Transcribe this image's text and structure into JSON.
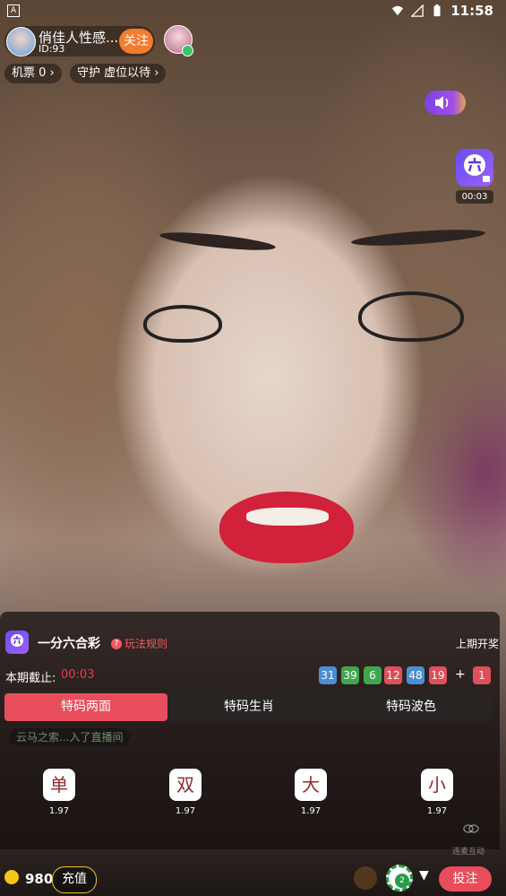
{
  "status_bar": {
    "notification_icon": "A",
    "time": "11:58",
    "icons": [
      "wifi-icon",
      "signal-icon",
      "battery-icon"
    ]
  },
  "host": {
    "name": "俏佳人性感...",
    "id_label": "ID:93",
    "follow_label": "关注"
  },
  "tags": {
    "tickets": "机票 0",
    "guard": "守护 虚位以待"
  },
  "floating_timer": "00:03",
  "chat_ghost": "云马之索...入了直播间",
  "lottery": {
    "title": "一分六合彩",
    "rules_label": "玩法规则",
    "last_draw_label": "上期开奖",
    "deadline_label": "本期截止:",
    "deadline_value": "00:03",
    "balls": [
      {
        "value": "31",
        "color": "#4a8fd6"
      },
      {
        "value": "39",
        "color": "#3fa64f"
      },
      {
        "value": "6",
        "color": "#3fa64f"
      },
      {
        "value": "12",
        "color": "#e0505a"
      },
      {
        "value": "48",
        "color": "#4a8fd6"
      },
      {
        "value": "19",
        "color": "#e0505a"
      }
    ],
    "plus": "+",
    "special_ball": {
      "value": "1",
      "color": "#e0505a"
    },
    "tabs": [
      "特码两面",
      "特码生肖",
      "特码波色"
    ],
    "active_tab": 0,
    "bets": [
      {
        "label": "单",
        "odds": "1.97"
      },
      {
        "label": "双",
        "odds": "1.97"
      },
      {
        "label": "大",
        "odds": "1.97"
      },
      {
        "label": "小",
        "odds": "1.97"
      }
    ]
  },
  "interaction_label": "连麦互动",
  "bottom": {
    "balance": "980",
    "recharge_label": "充值",
    "chip_value": "2",
    "submit_label": "投注"
  },
  "colors": {
    "accent_red": "#e84d5b",
    "follow_orange": "#f27b2f",
    "coin_gold": "#f5c518"
  }
}
